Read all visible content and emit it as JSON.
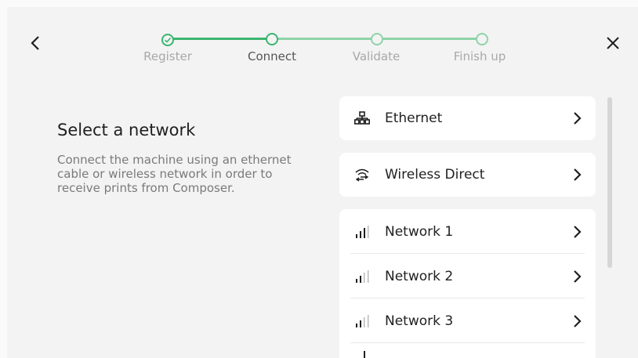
{
  "header": {
    "back_icon": "chevron-left-icon",
    "close_icon": "close-icon",
    "steps": [
      {
        "label": "Register",
        "state": "done"
      },
      {
        "label": "Connect",
        "state": "active"
      },
      {
        "label": "Validate",
        "state": "pending"
      },
      {
        "label": "Finish up",
        "state": "pending"
      }
    ]
  },
  "main": {
    "title": "Select a network",
    "description": "Connect the machine using an ethernet cable or wireless network in order to receive prints from Composer."
  },
  "connections": [
    {
      "label": "Ethernet",
      "icon": "ethernet-icon"
    },
    {
      "label": "Wireless Direct",
      "icon": "wireless-direct-icon"
    }
  ],
  "networks": [
    {
      "label": "Network 1",
      "icon": "signal-strength-icon"
    },
    {
      "label": "Network 2",
      "icon": "signal-strength-icon"
    },
    {
      "label": "Network 3",
      "icon": "signal-strength-icon"
    }
  ],
  "colors": {
    "accent": "#3bb56f",
    "accent_light": "#8fd3a9",
    "background": "#f3f3f3",
    "card": "#ffffff"
  }
}
